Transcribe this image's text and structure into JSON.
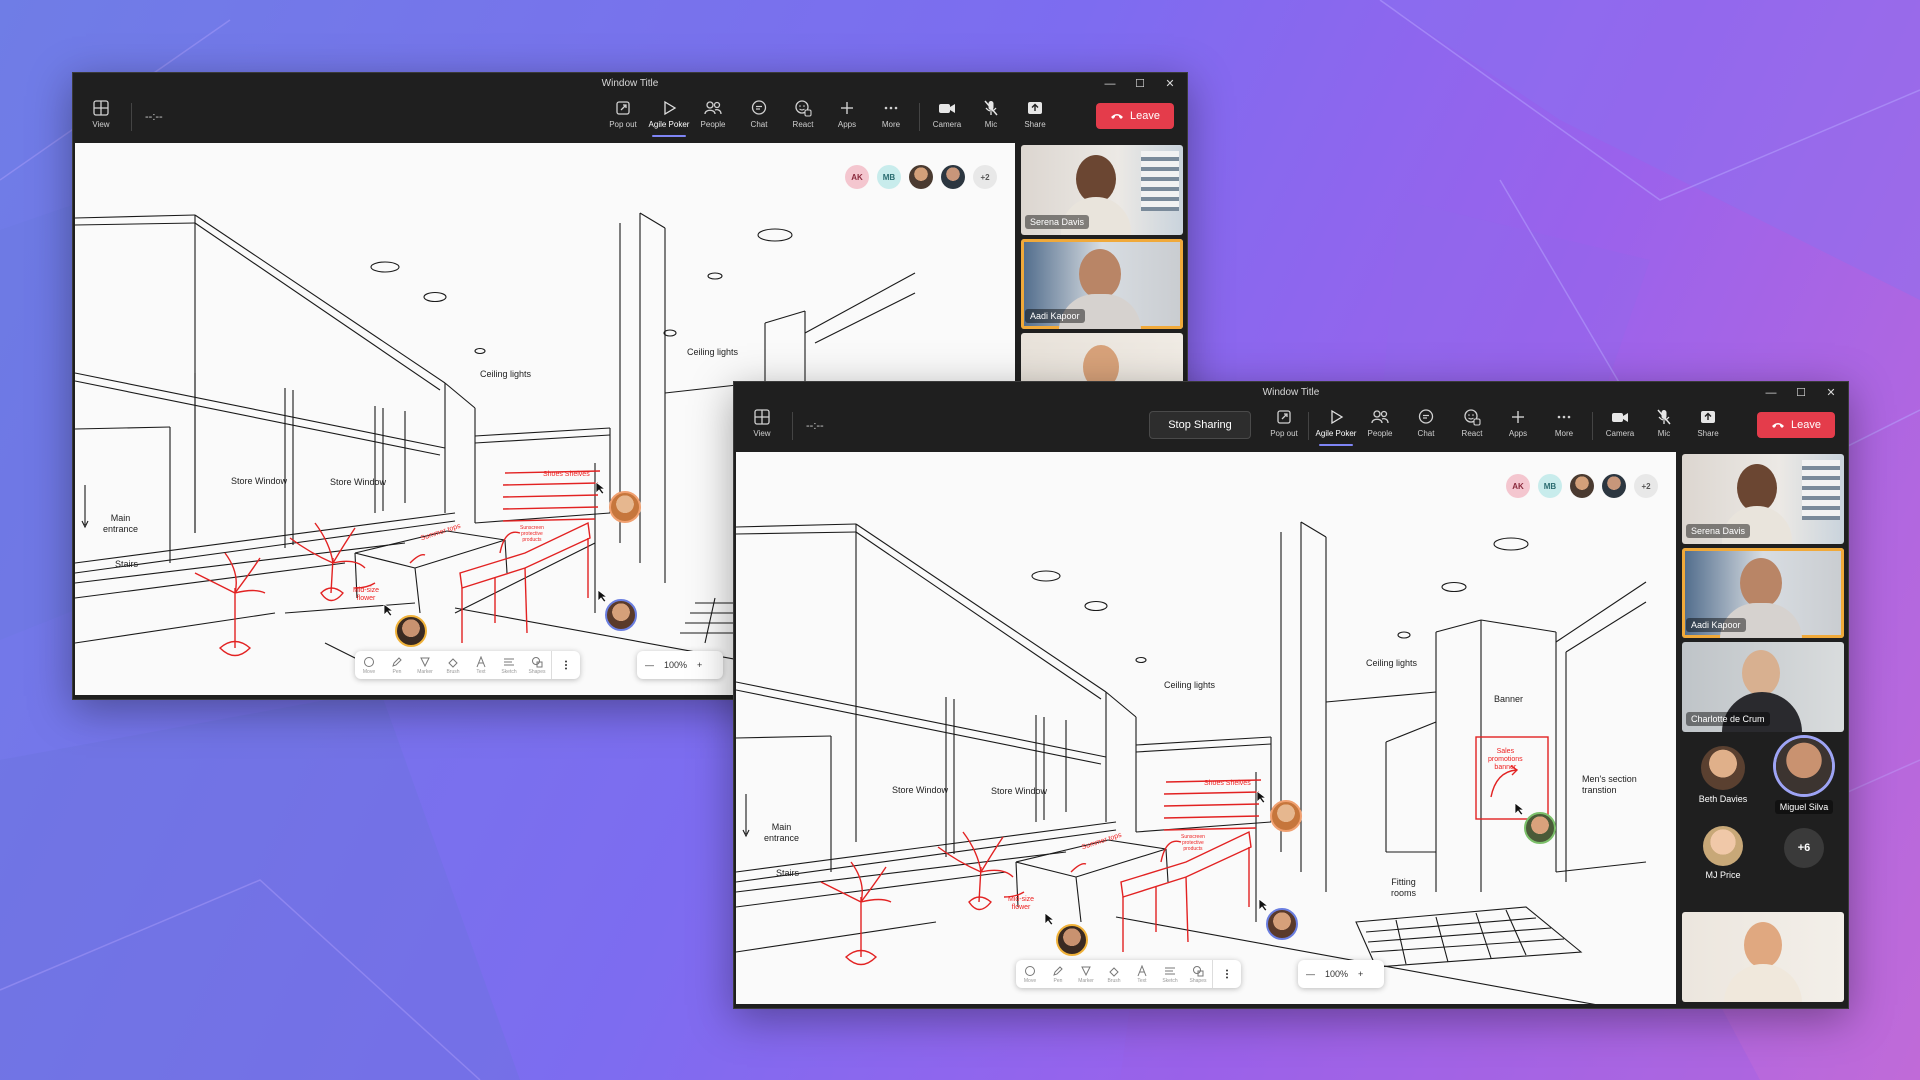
{
  "window_title": "Window Title",
  "timer": "--:--",
  "toolbar": {
    "view": "View",
    "pop_out": "Pop out",
    "agile_poker": "Agile Poker",
    "people": "People",
    "chat": "Chat",
    "react": "React",
    "apps": "Apps",
    "more": "More",
    "camera": "Camera",
    "mic": "Mic",
    "share": "Share",
    "leave": "Leave",
    "stop_sharing": "Stop Sharing"
  },
  "stage_avatars": {
    "initials_1": "AK",
    "initials_2": "MB",
    "overflow": "+2"
  },
  "sketch_labels": {
    "ceiling_lights": "Ceiling lights",
    "store_window": "Store Window",
    "main_entrance_1": "Main",
    "main_entrance_2": "entrance",
    "stairs": "Stairs",
    "banner": "Banner",
    "mens_section_1": "Men's section",
    "mens_section_2": "transtion",
    "fitting_rooms_1": "Fitting",
    "fitting_rooms_2": "rooms"
  },
  "red_notes": {
    "shoes_shelves": "Shoes Shelves",
    "summer_tops": "Summer tops",
    "sun_1": "Sunscreen",
    "sun_2": "protective",
    "sun_3": "products",
    "mid_1": "Mid-size",
    "mid_2": "flower",
    "sales_1": "Sales",
    "sales_2": "promotions",
    "sales_3": "banner"
  },
  "ink_tools": [
    "Move",
    "Pen",
    "Marker",
    "Brush",
    "Text",
    "Sketch",
    "Shapes"
  ],
  "zoom": "100%",
  "participants": {
    "serena": "Serena Davis",
    "aadi": "Aadi Kapoor",
    "charlotte": "Charlotte de Crum",
    "beth": "Beth Davies",
    "miguel": "Miguel Silva",
    "mj": "MJ Price",
    "overflow": "+6"
  },
  "colors": {
    "leave": "#e43c4b",
    "accent": "#7f85f5",
    "speaking": "#f0a93a",
    "ink_red": "#e22222"
  }
}
